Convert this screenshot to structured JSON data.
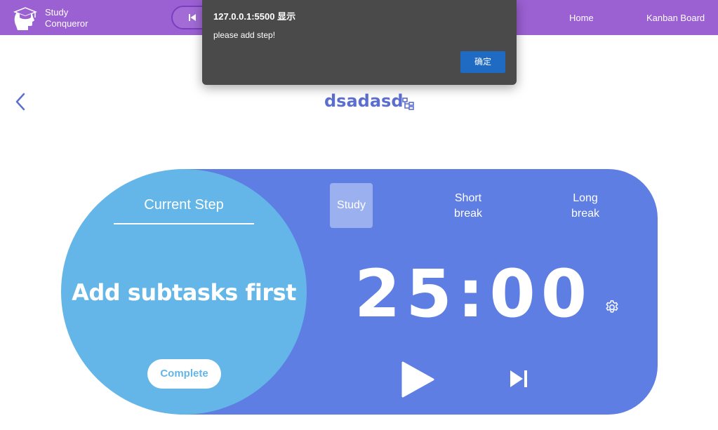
{
  "header": {
    "brand_line1": "Study",
    "brand_line2": "Conqueror",
    "nav": {
      "home": "Home",
      "kanban": "Kanban Board"
    },
    "color": "#9b60d2"
  },
  "task": {
    "title": "dsadasd"
  },
  "pomodoro": {
    "current_step_label": "Current Step",
    "step_message": "Add subtasks first",
    "complete_label": "Complete",
    "tabs": {
      "study": "Study",
      "short_line1": "Short",
      "short_line2": "break",
      "long_line1": "Long",
      "long_line2": "break"
    },
    "timer": "25:00",
    "card_color": "#5f7ee4",
    "circle_color": "#63b6e7"
  },
  "alert": {
    "title": "127.0.0.1:5500 显示",
    "message": "please add step!",
    "ok_label": "确定"
  },
  "icons": [
    "graduation-head-logo-icon",
    "skip-back-icon",
    "chevron-left-icon",
    "hierarchy-icon",
    "gear-icon",
    "play-icon",
    "skip-forward-icon"
  ]
}
